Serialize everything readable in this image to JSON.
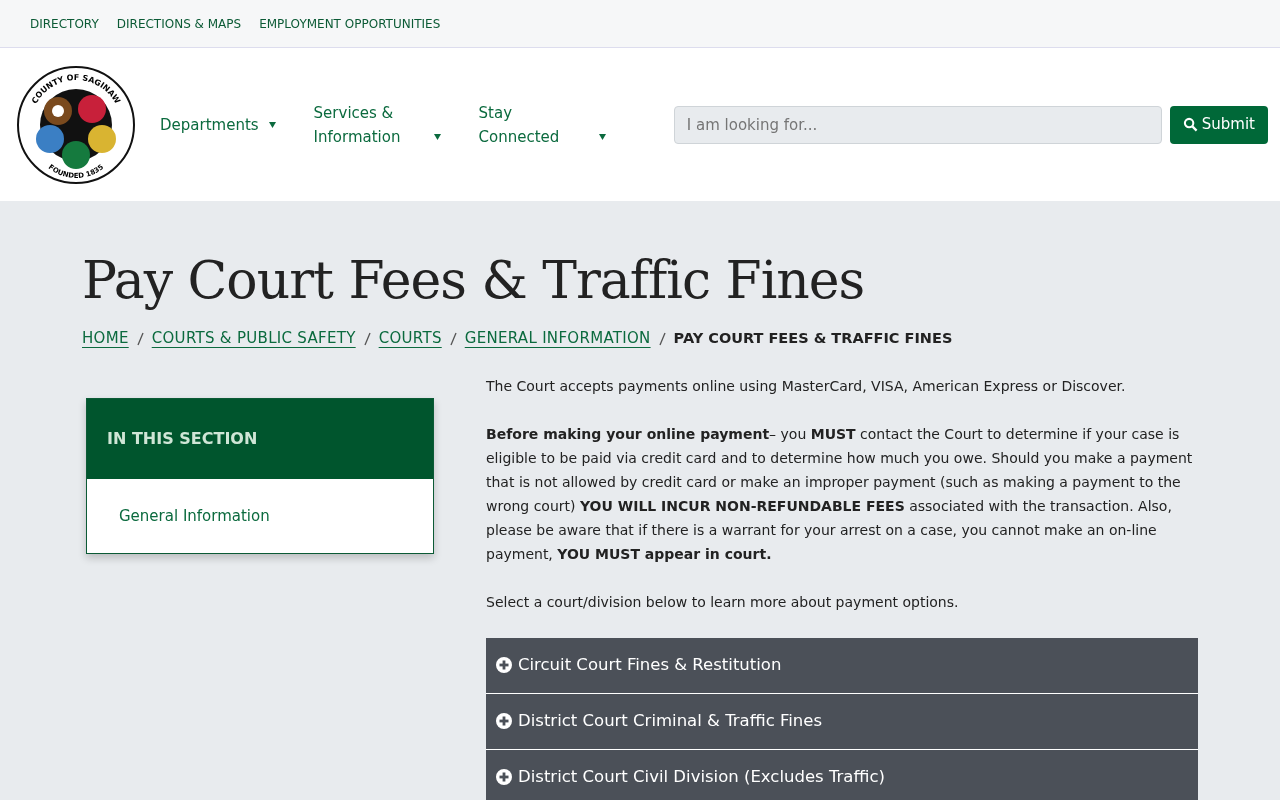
{
  "utility_nav": [
    "DIRECTORY",
    "DIRECTIONS & MAPS",
    "EMPLOYMENT OPPORTUNITIES"
  ],
  "logo": {
    "top_text": "COUNTY OF SAGINAW",
    "bottom_text": "FOUNDED 1835"
  },
  "main_nav": [
    {
      "label": "Departments",
      "expanded": false
    },
    {
      "label": "Services & Information",
      "expanded": false
    },
    {
      "label": "Stay Connected",
      "expanded": false
    }
  ],
  "search": {
    "placeholder": "I am looking for...",
    "button": "Submit"
  },
  "page_title": "Pay Court Fees & Traffic Fines",
  "breadcrumbs": [
    {
      "label": "HOME",
      "current": false
    },
    {
      "label": "COURTS & PUBLIC SAFETY",
      "current": false
    },
    {
      "label": "COURTS",
      "current": false
    },
    {
      "label": "GENERAL INFORMATION",
      "current": false
    },
    {
      "label": "PAY COURT FEES & TRAFFIC FINES",
      "current": true
    }
  ],
  "section_nav": {
    "title": "IN THIS SECTION",
    "items": [
      "General Information"
    ]
  },
  "paragraphs": [
    "The Court accepts payments online using MasterCard, VISA, American Express or Discover.",
    "**Before making your online payment**– you **MUST** contact the Court to determine if your case is eligible to be paid via credit card and to determine how much you owe. Should you make a payment that is not allowed by credit card or make an improper payment (such as making a payment to the wrong court) **YOU WILL INCUR NON-REFUNDABLE FEES** associated with the transaction. Also, please be aware that if there is a warrant for your arrest on a case, you cannot make an on-line payment, **YOU MUST appear in court.**",
    "Select a court/division below to learn more about payment options."
  ],
  "accordion": [
    {
      "label": "Circuit Court Fines & Restitution",
      "expanded": false
    },
    {
      "label": "District Court Criminal & Traffic Fines",
      "expanded": false
    },
    {
      "label": "District Court Civil Division (Excludes Traffic)",
      "expanded": false
    }
  ]
}
